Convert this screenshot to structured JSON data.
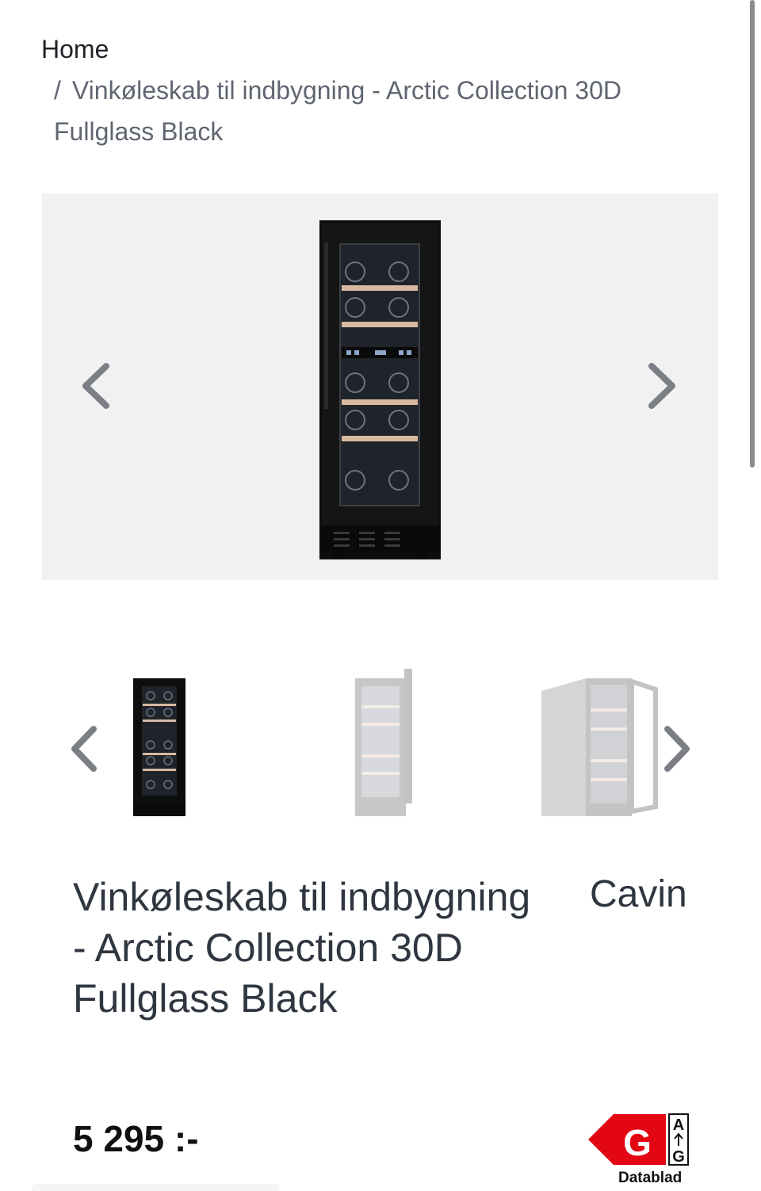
{
  "breadcrumb": {
    "home": "Home",
    "separator": "/",
    "current": "Vinkøleskab til indbygning - Arctic Collection 30D Fullglass Black"
  },
  "gallery": {
    "prev_icon": "chevron-left-icon",
    "next_icon": "chevron-right-icon",
    "panel_color": "#f1f1f1",
    "thumbnail_count": 3
  },
  "product": {
    "title": "Vinkøleskab til indbygning - Arctic Collection 30D Fullglass Black",
    "brand": "Cavin",
    "price": "5 295 :-"
  },
  "energy_label": {
    "class": "G",
    "scale_top": "A",
    "scale_bottom": "G",
    "color": "#e30613",
    "datasheet_label": "Datablad"
  }
}
